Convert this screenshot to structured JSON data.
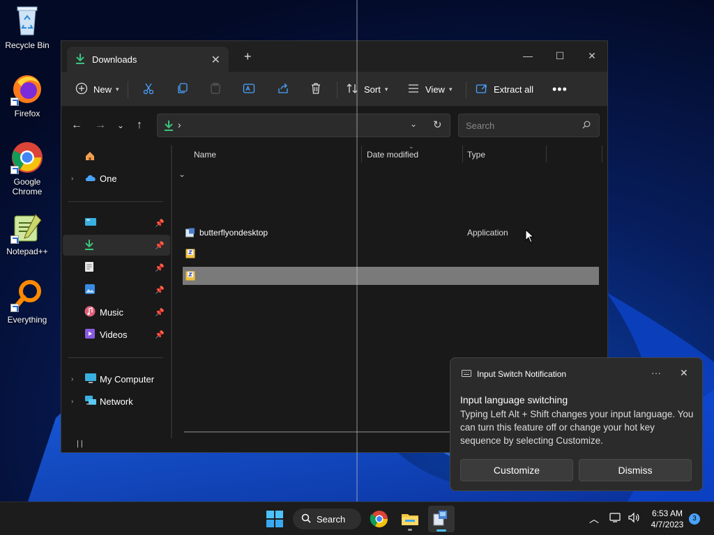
{
  "desktop": {
    "icons": [
      {
        "label": "Recycle Bin"
      },
      {
        "label": "Firefox"
      },
      {
        "label": "Google Chrome"
      },
      {
        "label": "Notepad++"
      },
      {
        "label": "Everything"
      }
    ]
  },
  "explorer": {
    "tab_title": "Downloads",
    "toolbar": {
      "new_label": "New",
      "sort_label": "Sort",
      "view_label": "View",
      "extract_label": "Extract all"
    },
    "address": {
      "separator": "›"
    },
    "search": {
      "placeholder": "Search"
    },
    "nav": {
      "onedrive": "One",
      "music": "Music",
      "videos": "Videos",
      "my_computer": "My Computer",
      "network": "Network"
    },
    "columns": {
      "name": "Name",
      "date_modified": "Date modified",
      "type": "Type"
    },
    "files": [
      {
        "name": "butterflyondesktop",
        "type": "Application"
      },
      {
        "name": "",
        "type": ""
      },
      {
        "name": "",
        "type": ""
      }
    ],
    "status": "|   |"
  },
  "toast": {
    "header": "Input Switch Notification",
    "more": "···",
    "title": "Input language switching",
    "body": "Typing Left Alt + Shift changes your input language. You can turn this feature off or change your hot key sequence by selecting Customize.",
    "customize_label": "Customize",
    "dismiss_label": "Dismiss"
  },
  "taskbar": {
    "search_label": "Search",
    "time": "6:53 AM",
    "date": "4/7/2023",
    "notification_count": "3"
  },
  "colors": {
    "accent": "#0078d4",
    "selection": "#7a7a7a",
    "download_green": "#3cc47c"
  }
}
